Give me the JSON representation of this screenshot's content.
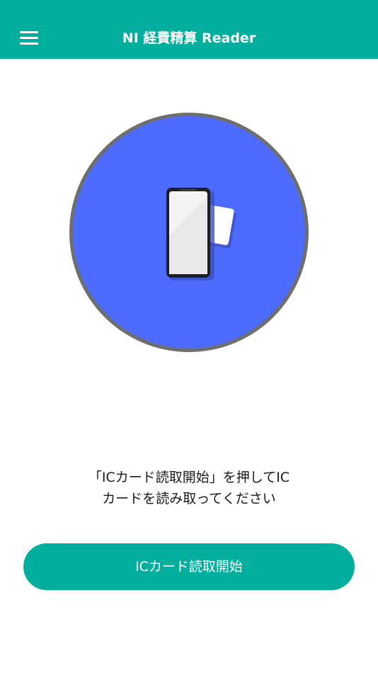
{
  "app": {
    "title": "NI 経費精算 Reader"
  },
  "header": {
    "menu_icon": "hamburger-menu-icon"
  },
  "illustration": {
    "icon": "phone-ic-card-tap-icon",
    "circle_color": "#4d6bfe",
    "ring_color": "#6e6e6e"
  },
  "instruction": {
    "line1": "「ICカード読取開始」を押してIC",
    "line2": "カードを読み取ってください"
  },
  "start_button": {
    "label": "ICカード読取開始"
  },
  "colors": {
    "accent": "#00ae9e",
    "background": "#ffffff"
  }
}
